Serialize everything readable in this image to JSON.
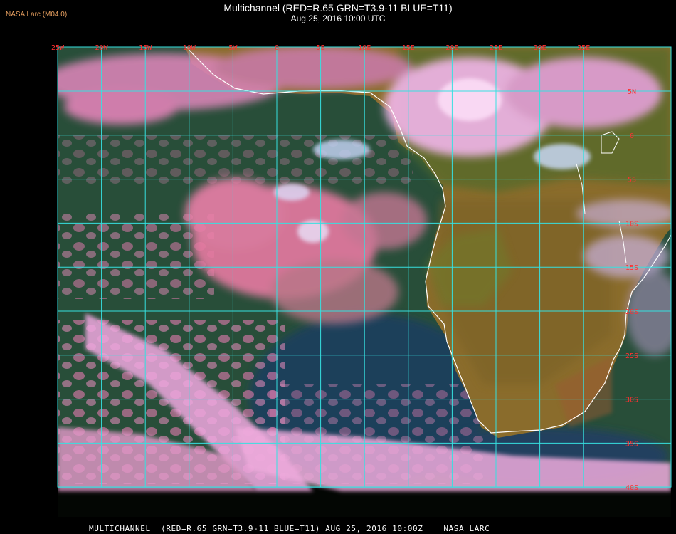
{
  "header": {
    "source_label": "NASA Larc (M04.0)",
    "title": "Multichannel (RED=R.65 GRN=T3.9-11 BLUE=T11)",
    "subtitle": "Aug 25, 2016 10:00 UTC"
  },
  "footer": {
    "text": "MULTICHANNEL  (RED=R.65 GRN=T3.9-11 BLUE=T11) AUG 25, 2016 10:00Z    NASA LARC"
  },
  "map": {
    "longitude_labels": [
      "25W",
      "20W",
      "15W",
      "10W",
      "5W",
      "0",
      "5E",
      "10E",
      "15E",
      "20E",
      "25E",
      "30E",
      "35E"
    ],
    "latitude_labels": [
      "5N",
      "0",
      "5S",
      "10S",
      "15S",
      "20S",
      "25S",
      "30S",
      "35S",
      "40S"
    ],
    "colors": {
      "grid": "#36e0e0",
      "coastline": "#ffffff",
      "labels": "#ff3030",
      "ocean": "#1d3f55",
      "land": "#8a6a2a",
      "cloud_pink": "#e47ab0",
      "cloud_bright": "#f6b8ec"
    }
  }
}
